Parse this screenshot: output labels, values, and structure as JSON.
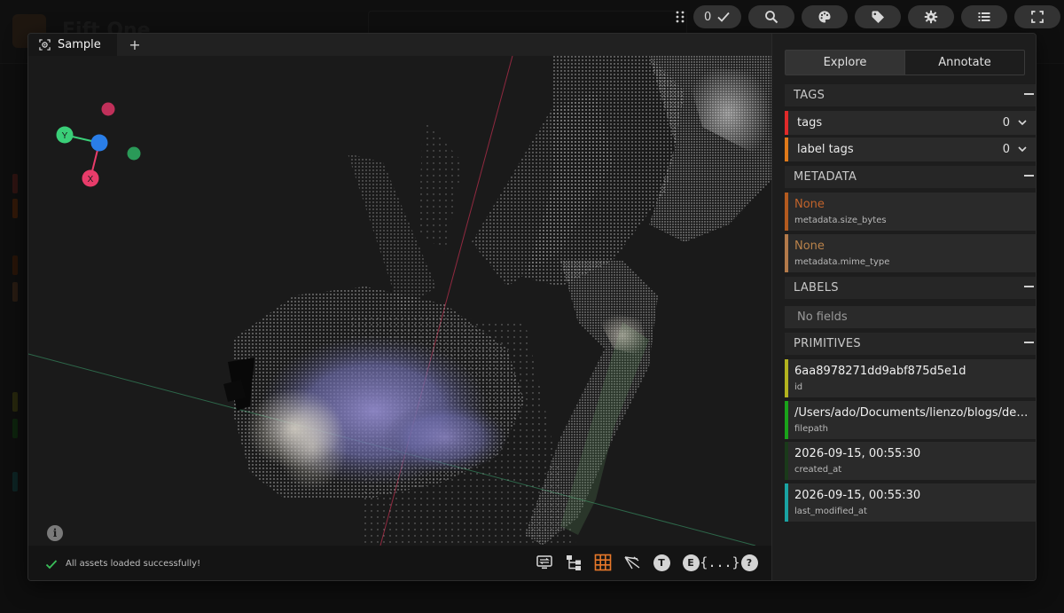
{
  "background": {
    "app_title": "Fift One"
  },
  "toolbar": {
    "selected_count": "0",
    "icons": [
      "drag-handle-icon",
      "checkmark-icon",
      "search-icon",
      "palette-icon",
      "tag-icon",
      "gear-icon",
      "list-icon",
      "fullscreen-icon",
      "chevron-right-icon"
    ]
  },
  "modal": {
    "tab": {
      "label": "Sample",
      "icon": "scene-3d-icon"
    },
    "add_tab": "+",
    "status": {
      "message": "All assets loaded successfully!"
    },
    "axes_gizmo": {
      "y_label": "Y",
      "x_label": "X"
    },
    "info": "i",
    "tools": {
      "t_label": "T",
      "e_label": "E",
      "json_label": "{...}",
      "help_label": "?"
    }
  },
  "sidebar": {
    "modes": {
      "explore": "Explore",
      "annotate": "Annotate"
    },
    "tags": {
      "header": "TAGS",
      "rows": [
        {
          "label": "tags",
          "count": "0",
          "color": "#e02a2a"
        },
        {
          "label": "label tags",
          "count": "0",
          "color": "#e07a1a"
        }
      ]
    },
    "metadata": {
      "header": "METADATA",
      "fields": [
        {
          "value": "None",
          "key": "metadata.size_bytes",
          "color": "#b35a1f"
        },
        {
          "value": "None",
          "key": "metadata.mime_type",
          "color": "#b37a4a"
        }
      ]
    },
    "labels": {
      "header": "LABELS",
      "empty": "No fields"
    },
    "primitives": {
      "header": "PRIMITIVES",
      "fields": [
        {
          "value": "6aa8978271dd9abf875d5e1d",
          "key": "id",
          "color": "#b3b31f"
        },
        {
          "value": "/Users/ado/Documents/lienzo/blogs/depth",
          "key": "filepath",
          "color": "#1aa31a"
        },
        {
          "value": "2026-09-15, 00:55:30",
          "key": "created_at",
          "color": "#1a3a1a"
        },
        {
          "value": "2026-09-15, 00:55:30",
          "key": "last_modified_at",
          "color": "#1aa3a3"
        }
      ]
    }
  }
}
